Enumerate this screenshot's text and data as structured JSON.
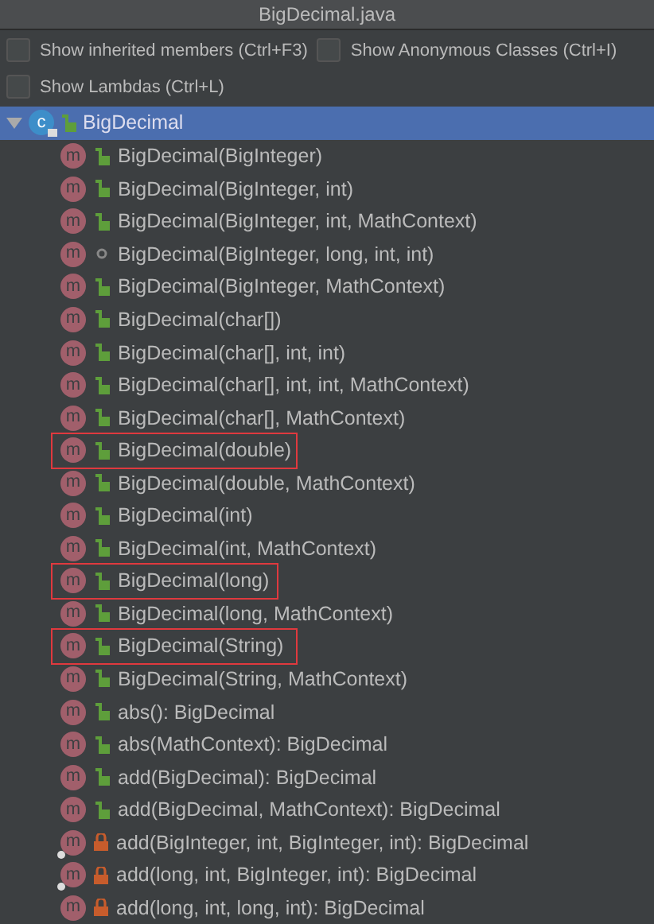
{
  "window": {
    "title": "BigDecimal.java"
  },
  "options": [
    {
      "label": "Show inherited members (Ctrl+F3)",
      "checked": false
    },
    {
      "label": "Show Anonymous Classes (Ctrl+I)",
      "checked": false
    },
    {
      "label": "Show Lambdas (Ctrl+L)",
      "checked": false
    }
  ],
  "tree": {
    "badge": "c",
    "kind": "public",
    "label": "BigDecimal",
    "expanded": true,
    "selected": true,
    "children": [
      {
        "badge": "m",
        "label": "BigDecimal(BigInteger)",
        "kind": "public",
        "static": false,
        "highlighted": false
      },
      {
        "badge": "m",
        "label": "BigDecimal(BigInteger, int)",
        "kind": "public",
        "static": false,
        "highlighted": false
      },
      {
        "badge": "m",
        "label": "BigDecimal(BigInteger, int, MathContext)",
        "kind": "public",
        "static": false,
        "highlighted": false
      },
      {
        "badge": "m",
        "label": "BigDecimal(BigInteger, long, int, int)",
        "kind": "package",
        "static": false,
        "highlighted": false
      },
      {
        "badge": "m",
        "label": "BigDecimal(BigInteger, MathContext)",
        "kind": "public",
        "static": false,
        "highlighted": false
      },
      {
        "badge": "m",
        "label": "BigDecimal(char[])",
        "kind": "public",
        "static": false,
        "highlighted": false
      },
      {
        "badge": "m",
        "label": "BigDecimal(char[], int, int)",
        "kind": "public",
        "static": false,
        "highlighted": false
      },
      {
        "badge": "m",
        "label": "BigDecimal(char[], int, int, MathContext)",
        "kind": "public",
        "static": false,
        "highlighted": false
      },
      {
        "badge": "m",
        "label": "BigDecimal(char[], MathContext)",
        "kind": "public",
        "static": false,
        "highlighted": false
      },
      {
        "badge": "m",
        "label": "BigDecimal(double)",
        "kind": "public",
        "static": false,
        "highlighted": true
      },
      {
        "badge": "m",
        "label": "BigDecimal(double, MathContext)",
        "kind": "public",
        "static": false,
        "highlighted": false
      },
      {
        "badge": "m",
        "label": "BigDecimal(int)",
        "kind": "public",
        "static": false,
        "highlighted": false
      },
      {
        "badge": "m",
        "label": "BigDecimal(int, MathContext)",
        "kind": "public",
        "static": false,
        "highlighted": false
      },
      {
        "badge": "m",
        "label": "BigDecimal(long)",
        "kind": "public",
        "static": false,
        "highlighted": true
      },
      {
        "badge": "m",
        "label": "BigDecimal(long, MathContext)",
        "kind": "public",
        "static": false,
        "highlighted": false
      },
      {
        "badge": "m",
        "label": "BigDecimal(String)",
        "kind": "public",
        "static": false,
        "highlighted": true
      },
      {
        "badge": "m",
        "label": "BigDecimal(String, MathContext)",
        "kind": "public",
        "static": false,
        "highlighted": false
      },
      {
        "badge": "m",
        "label": "abs(): BigDecimal",
        "kind": "public",
        "static": false,
        "highlighted": false
      },
      {
        "badge": "m",
        "label": "abs(MathContext): BigDecimal",
        "kind": "public",
        "static": false,
        "highlighted": false
      },
      {
        "badge": "m",
        "label": "add(BigDecimal): BigDecimal",
        "kind": "public",
        "static": false,
        "highlighted": false
      },
      {
        "badge": "m",
        "label": "add(BigDecimal, MathContext): BigDecimal",
        "kind": "public",
        "static": false,
        "highlighted": false
      },
      {
        "badge": "m",
        "label": "add(BigInteger, int, BigInteger, int): BigDecimal",
        "kind": "private",
        "static": true,
        "highlighted": false
      },
      {
        "badge": "m",
        "label": "add(long, int, BigInteger, int): BigDecimal",
        "kind": "private",
        "static": true,
        "highlighted": false
      },
      {
        "badge": "m",
        "label": "add(long, int, long, int): BigDecimal",
        "kind": "private",
        "static": false,
        "highlighted": false
      }
    ]
  }
}
